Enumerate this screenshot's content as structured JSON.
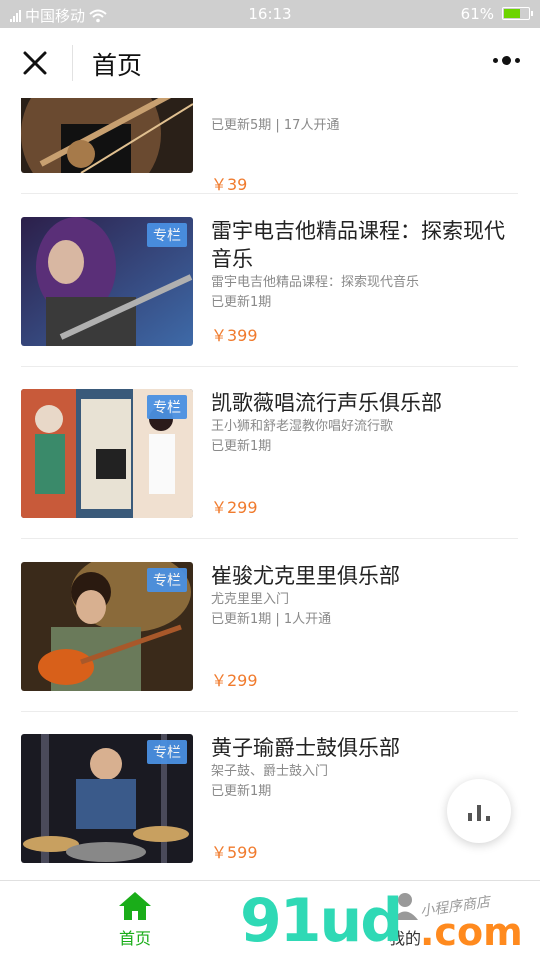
{
  "status": {
    "carrier": "中国移动",
    "time": "16:13",
    "battery": "61%"
  },
  "nav": {
    "title": "首页"
  },
  "items": [
    {
      "title": "",
      "subtitle": "",
      "meta": "已更新5期 | 17人开通",
      "price": "￥39",
      "badge": ""
    },
    {
      "title": "雷宇电吉他精品课程：探索现代音乐",
      "subtitle": "雷宇电吉他精品课程：探索现代音乐",
      "meta": "已更新1期",
      "price": "￥399",
      "badge": "专栏"
    },
    {
      "title": "凯歌薇唱流行声乐俱乐部",
      "subtitle": "王小狮和舒老湿教你唱好流行歌",
      "meta": "已更新1期",
      "price": "￥299",
      "badge": "专栏"
    },
    {
      "title": "崔骏尤克里里俱乐部",
      "subtitle": "尤克里里入门",
      "meta": "已更新1期 | 1人开通",
      "price": "￥299",
      "badge": "专栏"
    },
    {
      "title": "黄子瑜爵士鼓俱乐部",
      "subtitle": "架子鼓、爵士鼓入门",
      "meta": "已更新1期",
      "price": "￥599",
      "badge": "专栏"
    }
  ],
  "tabbar": {
    "home": "首页",
    "mine": "我的"
  },
  "watermark": {
    "logo": "91ud",
    "domain": ".com",
    "tagline": "小程序商店"
  },
  "colors": {
    "accent": "#1aad19",
    "price": "#f07b2e",
    "badge": "#4a90e2"
  }
}
